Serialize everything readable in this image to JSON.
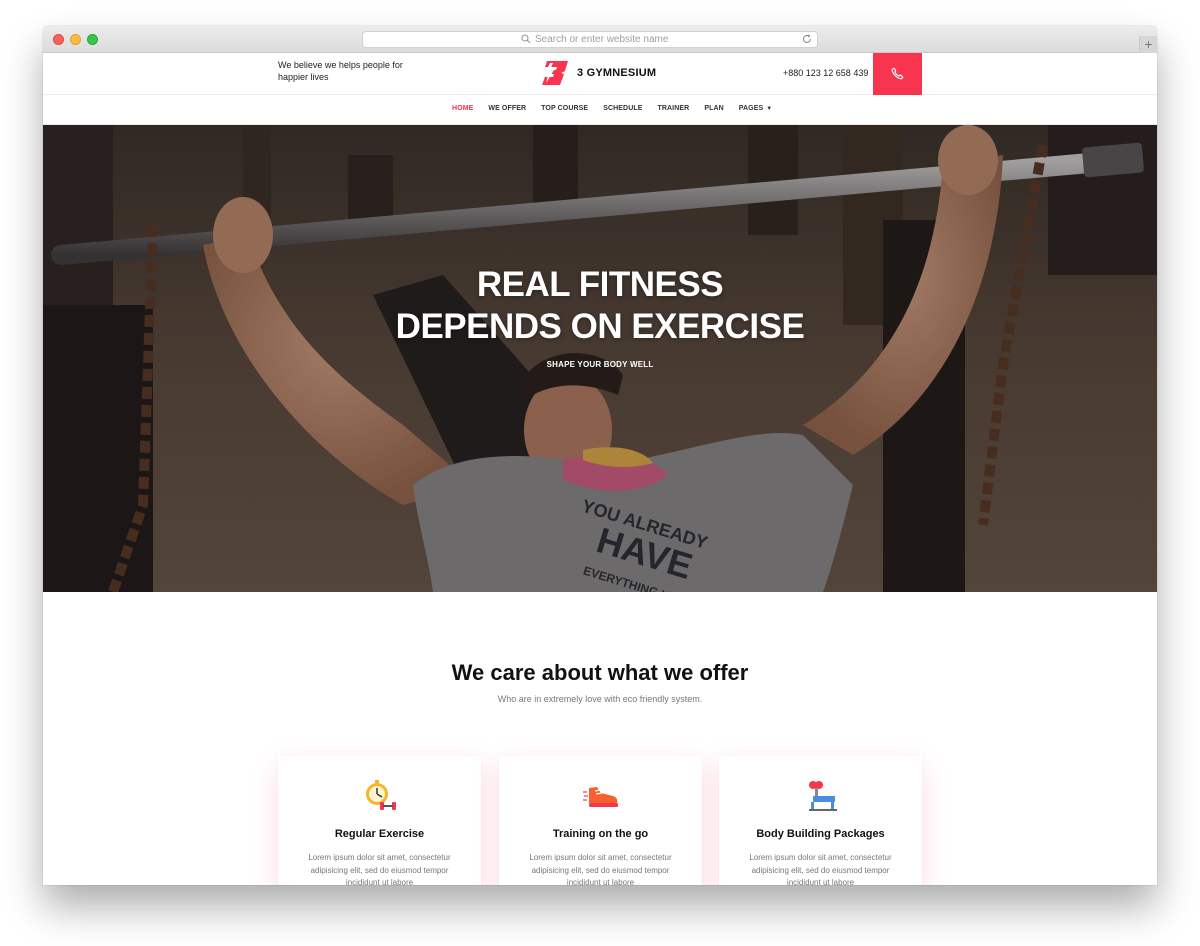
{
  "browser": {
    "url_placeholder": "Search or enter website name",
    "new_tab_label": "+"
  },
  "header": {
    "tagline": "We believe we helps people for happier lives",
    "brand_name": "3 GYMNESIUM",
    "phone": "+880 123 12 658 439"
  },
  "nav": {
    "items": [
      {
        "label": "HOME",
        "active": true
      },
      {
        "label": "WE OFFER",
        "active": false
      },
      {
        "label": "TOP COURSE",
        "active": false
      },
      {
        "label": "SCHEDULE",
        "active": false
      },
      {
        "label": "TRAINER",
        "active": false
      },
      {
        "label": "PLAN",
        "active": false
      },
      {
        "label": "PAGES",
        "active": false
      }
    ]
  },
  "hero": {
    "title_line1": "REAL FITNESS",
    "title_line2": "DEPENDS ON EXERCISE",
    "subtitle": "SHAPE YOUR BODY WELL",
    "shirt_text_1": "YOU ALREADY",
    "shirt_text_2": "HAVE",
    "shirt_text_3": "EVERYTHING YOU NEED"
  },
  "offer": {
    "title": "We care about what we offer",
    "subtitle": "Who are in extremely love with eco friendly system.",
    "cards": [
      {
        "title": "Regular Exercise",
        "text": "Lorem ipsum dolor sit amet, consectetur adipisicing elit, sed do eiusmod tempor incididunt ut labore",
        "icon": "stopwatch-dumbbell-icon"
      },
      {
        "title": "Training on the go",
        "text": "Lorem ipsum dolor sit amet, consectetur adipisicing elit, sed do eiusmod tempor incididunt ut labore",
        "icon": "running-shoe-icon"
      },
      {
        "title": "Body Building Packages",
        "text": "Lorem ipsum dolor sit amet, consectetur adipisicing elit, sed do eiusmod tempor incididunt ut labore",
        "icon": "bench-press-icon"
      }
    ]
  },
  "colors": {
    "accent": "#f8344f",
    "text_dark": "#111111",
    "text_muted": "#777777"
  }
}
